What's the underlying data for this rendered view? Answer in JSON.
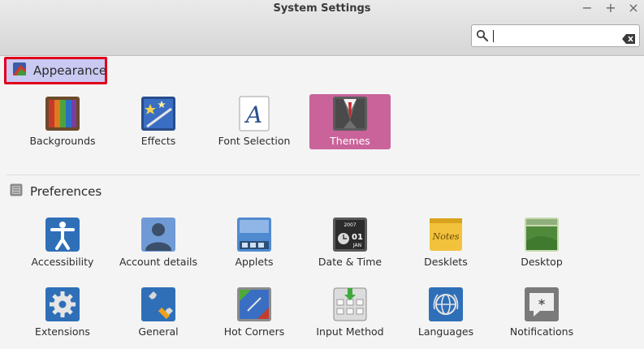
{
  "window": {
    "title": "System Settings",
    "controls": [
      "−",
      "+",
      "×"
    ]
  },
  "search": {
    "value": "",
    "placeholder": ""
  },
  "sections": {
    "appearance": {
      "label": "Appearance",
      "items": [
        "Backgrounds",
        "Effects",
        "Font Selection",
        "Themes"
      ],
      "selected": "Themes"
    },
    "preferences": {
      "label": "Preferences",
      "items": [
        "Accessibility",
        "Account details",
        "Applets",
        "Date & Time",
        "Desklets",
        "Desktop",
        "Extensions",
        "General",
        "Hot Corners",
        "Input Method",
        "Languages",
        "Notifications"
      ]
    }
  },
  "icons": {
    "datetime_year": "2007",
    "datetime_day": "01",
    "datetime_month": "JAN",
    "desklets_note": "Notes"
  },
  "colors": {
    "selected_bg": "#c9639a",
    "highlight_bg": "#c9c9f2",
    "highlight_border": "#e0001a"
  }
}
